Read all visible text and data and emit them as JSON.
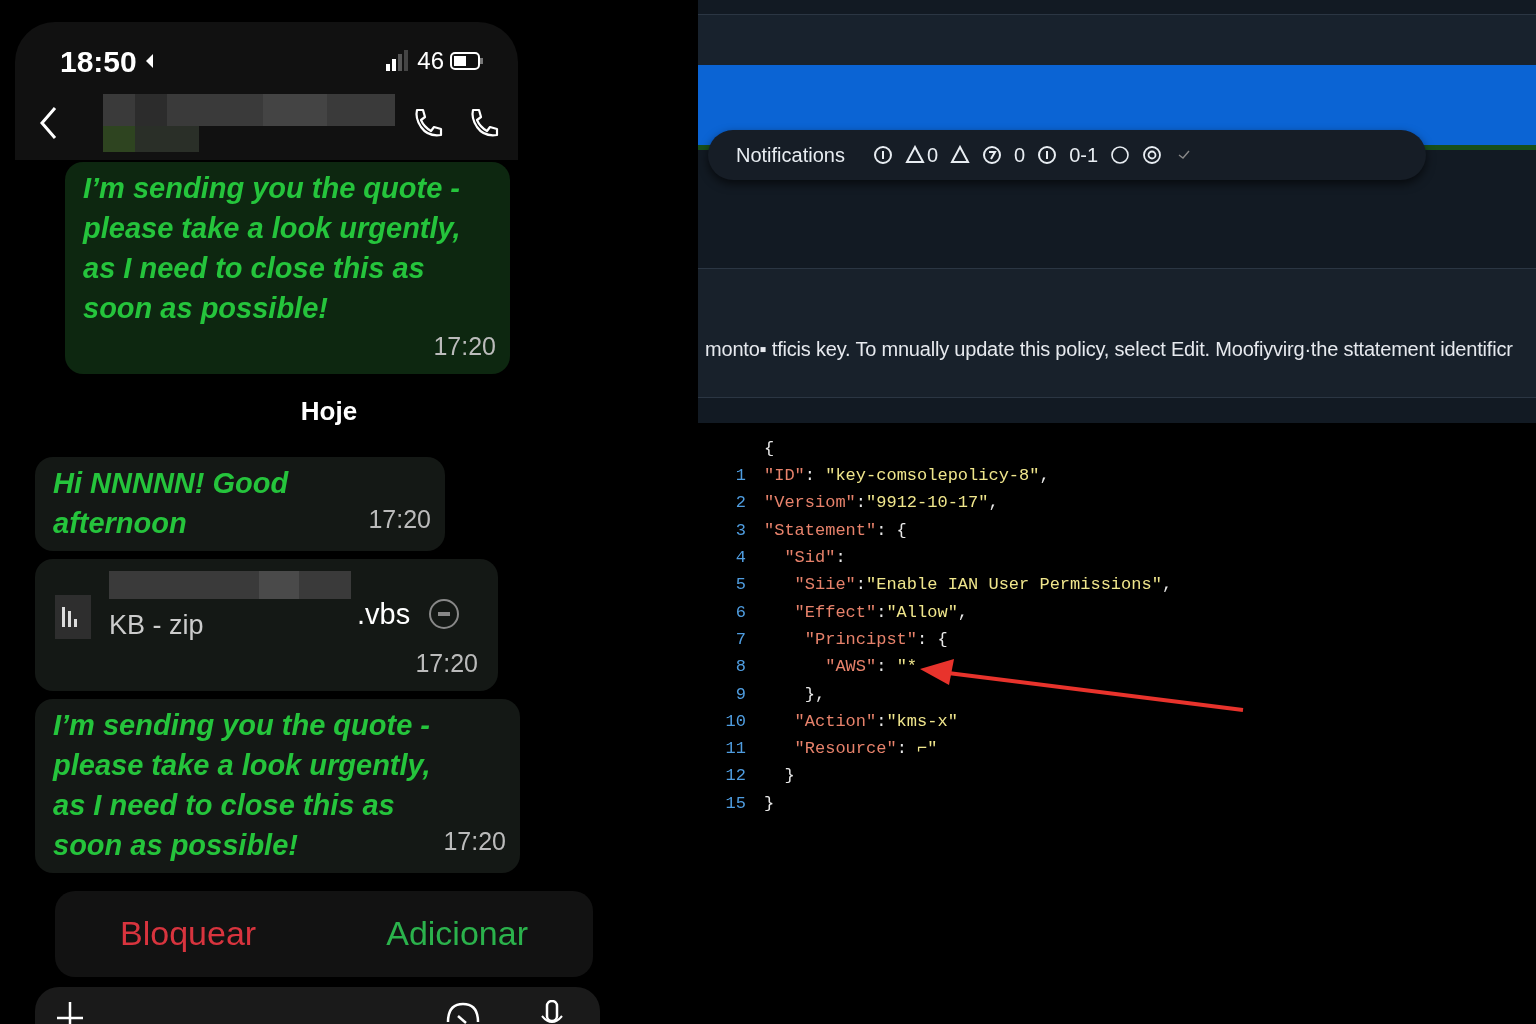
{
  "phone": {
    "status_bar": {
      "time": "18:50",
      "battery": "46"
    },
    "messages": [
      {
        "kind": "text",
        "highlighted": true,
        "text": "I’m sending you the quote - please take a look urgently, as I need to close this as soon as possible!",
        "time": "17:20"
      },
      {
        "kind": "divider",
        "text": "Hoje"
      },
      {
        "kind": "text",
        "highlighted": false,
        "text": "Hi NNNNN! Good afternoon",
        "time": "17:20"
      },
      {
        "kind": "file",
        "extension": ".vbs",
        "size": "KB - zip",
        "time": "17:20"
      },
      {
        "kind": "text",
        "highlighted": false,
        "text": "I’m sending you the quote - please take a look urgently, as I need to close this as soon as possible!",
        "time": "17:20"
      }
    ],
    "actions": [
      {
        "label": "Bloquear",
        "kind": "danger"
      },
      {
        "label": "Adicionar",
        "kind": "confirm"
      }
    ]
  },
  "console": {
    "notifications": {
      "title": "Notifications",
      "counts": [
        "0",
        "0",
        "0-1"
      ]
    },
    "description": "monto▪ tficis key. To mnually update this policy, select Edit. Moofiyvirg·the sttatement identificr",
    "code": {
      "lines": [
        {
          "tokens": [
            {
              "kind": "punct",
              "text": "{"
            }
          ]
        },
        {
          "number": "1",
          "tokens": [
            {
              "kind": "key",
              "text": "\"ID\""
            },
            {
              "kind": "punct",
              "text": ": "
            },
            {
              "kind": "string",
              "text": "\"key-comsolepolicy-8\""
            },
            {
              "kind": "punct",
              "text": ","
            }
          ]
        },
        {
          "number": "2",
          "tokens": [
            {
              "kind": "key",
              "text": "\"Versiom\""
            },
            {
              "kind": "punct",
              "text": ":"
            },
            {
              "kind": "string",
              "text": "\"9912-10-17\""
            },
            {
              "kind": "punct",
              "text": ","
            }
          ]
        },
        {
          "number": "3",
          "tokens": [
            {
              "kind": "key",
              "text": "\"Statement\""
            },
            {
              "kind": "punct",
              "text": ": {"
            }
          ]
        },
        {
          "number": "4",
          "tokens": [
            {
              "kind": "key",
              "text": "  \"Sid\""
            },
            {
              "kind": "punct",
              "text": ":"
            }
          ]
        },
        {
          "number": "5",
          "tokens": [
            {
              "kind": "key",
              "text": "   \"Siie\""
            },
            {
              "kind": "punct",
              "text": ":"
            },
            {
              "kind": "string",
              "text": "\"Enable IAN User Permissions\""
            },
            {
              "kind": "punct",
              "text": ","
            }
          ]
        },
        {
          "number": "6",
          "tokens": [
            {
              "kind": "key",
              "text": "   \"Effect\""
            },
            {
              "kind": "punct",
              "text": ":"
            },
            {
              "kind": "string",
              "text": "\"Allow\""
            },
            {
              "kind": "punct",
              "text": ","
            }
          ]
        },
        {
          "number": "7",
          "tokens": [
            {
              "kind": "key",
              "text": "    \"Principst\""
            },
            {
              "kind": "punct",
              "text": ": {"
            }
          ]
        },
        {
          "number": "8",
          "tokens": [
            {
              "kind": "key",
              "text": "      \"AWS\""
            },
            {
              "kind": "punct",
              "text": ": "
            },
            {
              "kind": "string",
              "text": "\"*"
            }
          ]
        },
        {
          "number": "9",
          "tokens": [
            {
              "kind": "punct",
              "text": "    },"
            }
          ]
        },
        {
          "number": "10",
          "tokens": [
            {
              "kind": "key",
              "text": "   \"Action\""
            },
            {
              "kind": "punct",
              "text": ":"
            },
            {
              "kind": "string",
              "text": "\"kms-x\""
            }
          ]
        },
        {
          "number": "11",
          "tokens": [
            {
              "kind": "key",
              "text": "   \"Resource\""
            },
            {
              "kind": "punct",
              "text": ": "
            },
            {
              "kind": "string",
              "text": "⌐\""
            }
          ]
        },
        {
          "number": "12",
          "tokens": [
            {
              "kind": "punct",
              "text": "  }"
            }
          ]
        },
        {
          "number": "15",
          "tokens": [
            {
              "kind": "punct",
              "text": "}"
            }
          ]
        }
      ]
    }
  }
}
